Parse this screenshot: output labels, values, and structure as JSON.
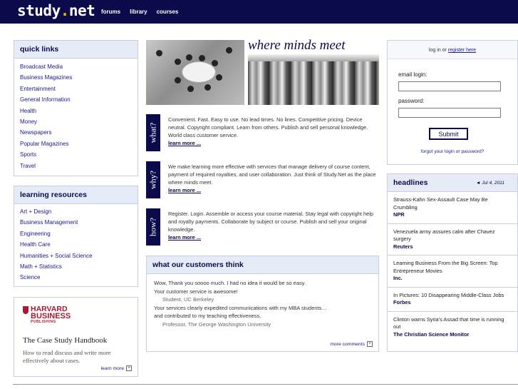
{
  "site": {
    "logo_text": "study",
    "logo_dot": ".",
    "logo_suffix": "net"
  },
  "topnav": [
    "forums",
    "library",
    "courses"
  ],
  "quick_links": {
    "title": "quick links",
    "items": [
      "Broadcast Media",
      "Business Magazines",
      "Entertainment",
      "General Information",
      "Health",
      "Money",
      "Newspapers",
      "Popular Magazines",
      "Sports",
      "Travel"
    ]
  },
  "learning_resources": {
    "title": "learning resources",
    "items": [
      "Art + Design",
      "Business Management",
      "Engineering",
      "Health Care",
      "Humanities + Social Science",
      "Math + Statistics",
      "Science"
    ]
  },
  "hbs": {
    "logo_line1": "HARVARD",
    "logo_line2": "BUSINESS",
    "logo_line3": "PUBLISHING",
    "title": "The Case Study Handbook",
    "desc": "How to read discuss and write more effectively about cases.",
    "more": "learn more",
    "more_icon": "plus-box-icon"
  },
  "hero": {
    "tagline": "where minds meet"
  },
  "questions": [
    {
      "tab": "what?",
      "text": "Convenient. Fast. Easy to use. No lead times. No lines. Competitive pricing. Device neutral. Copyright compliant. Learn from others. Publish and sell personal knowledge. World class customer service.",
      "more": "learn more ..."
    },
    {
      "tab": "why?",
      "text": "We make learning more effective with services that manage delivery of course content, payment of required royalties, and user collaboration. Just think of Study.Net as the place where minds meet.",
      "more": "learn more ..."
    },
    {
      "tab": "how?",
      "text": "Register. Login. Assemble or access your course material. Stay legal with copyright help and royalty payments. Collaborate by subject or course. Publish and sell your original knowledge.",
      "more": "learn more ..."
    }
  ],
  "testimonials": {
    "title": "what our customers think",
    "items": [
      {
        "quote1": "Wow, Thank you soooo much. I had no idea it would be so easy.",
        "quote2": "Your customer service is awesome!",
        "author": "Student, UC Berkeley"
      },
      {
        "quote1": "Your services clearly expedited communications with my MBA students…",
        "quote2": "and contributed to my teaching effectiveness.",
        "author": "Professor, The George Washington University"
      }
    ],
    "more": "more comments",
    "more_icon": "plus-box-icon"
  },
  "login": {
    "prefix": "log in or ",
    "register": "register here",
    "email_label": "email login:",
    "email_value": "",
    "password_label": "password:",
    "password_value": "",
    "submit": "Submit",
    "forgot": "forgot your login or password?"
  },
  "headlines": {
    "title": "headlines",
    "date_arrow": "◄",
    "date": "Jul 4, 2011",
    "items": [
      {
        "title": "Strauss-Kahn Sex-Assault Case May Be Crumbling",
        "source": "NPR"
      },
      {
        "title": "Venezuela army assures calm after Chavez surgery",
        "source": "Reuters"
      },
      {
        "title": "Learning Business From the Big Screen: Top Entrepreneur Movies",
        "source": "Inc."
      },
      {
        "title": "In Pictures: 10 Disappearing Middle-Class Jobs",
        "source": "Forbes"
      },
      {
        "title": "Clinton warns Syria's Assad that time is running out",
        "source": "The Christian Science Monitor"
      }
    ]
  },
  "colors": {
    "navy": "#0b0b4b",
    "panel_bg": "#e6ebf8",
    "link": "#1a1a8c",
    "accent_dot": "#f0b000",
    "hbs_red": "#a6192e"
  }
}
